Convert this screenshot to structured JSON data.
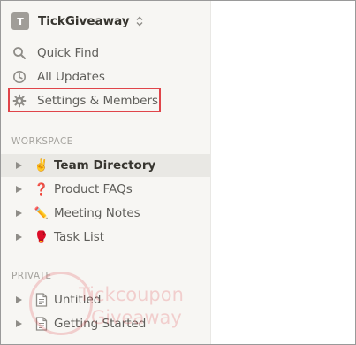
{
  "workspace": {
    "initial": "T",
    "name": "TickGiveaway"
  },
  "nav": [
    {
      "label": "Quick Find",
      "icon": "search-icon"
    },
    {
      "label": "All Updates",
      "icon": "clock-icon"
    },
    {
      "label": "Settings & Members",
      "icon": "gear-icon",
      "highlighted": true
    }
  ],
  "sections": {
    "workspace_title": "WORKSPACE",
    "private_title": "PRIVATE"
  },
  "workspace_pages": [
    {
      "emoji": "✌️",
      "label": "Team Directory",
      "active": true
    },
    {
      "emoji": "❓",
      "label": "Product FAQs"
    },
    {
      "emoji": "✏️",
      "label": "Meeting Notes"
    },
    {
      "emoji": "🥊",
      "label": "Task List"
    }
  ],
  "private_pages": [
    {
      "icon": "document-icon",
      "label": "Untitled"
    },
    {
      "icon": "document-icon",
      "label": "Getting Started"
    }
  ],
  "watermark": {
    "line1": "Tickcoupon",
    "line2": "Giveaway"
  },
  "colors": {
    "highlight_border": "#e0454a",
    "sidebar_bg": "#f7f6f3",
    "active_row_bg": "#e9e8e4"
  }
}
